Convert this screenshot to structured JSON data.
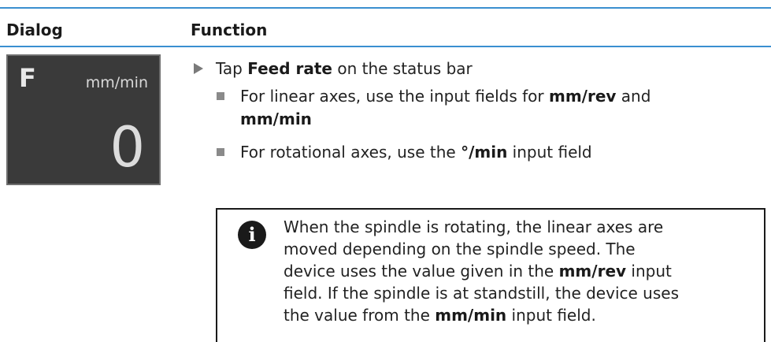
{
  "table": {
    "col_dialog": "Dialog",
    "col_function": "Function"
  },
  "tile": {
    "letter": "F",
    "unit": "mm/min",
    "value": "0"
  },
  "steps": {
    "step1_pre": "Tap ",
    "step1_bold": "Feed rate",
    "step1_post": " on the status bar",
    "bullet1_pre": "For linear axes, use the input fields for ",
    "bullet1_bold1": "mm/rev",
    "bullet1_mid": " and",
    "bullet1_bold2": "mm/min",
    "bullet2_pre": "For rotational axes, use the ",
    "bullet2_bold": "°/min",
    "bullet2_post": " input field"
  },
  "note": {
    "icon_glyph": "i",
    "line1": "When the spindle is rotating, the linear axes are",
    "line2": "moved depending on the spindle speed. The",
    "line3_pre": "device uses the value given in the ",
    "line3_bold": "mm/rev",
    "line3_post": " input",
    "line4": "field. If the spindle is at standstill, the device uses",
    "line5_pre": "the value from the ",
    "line5_bold": "mm/min",
    "line5_post": " input field."
  },
  "colors": {
    "rule": "#3a8fd0",
    "tile_bg": "#3a3a3a",
    "tile_border": "#6e6e6e"
  },
  "icons": [
    "step-arrow-icon",
    "bullet-square-icon",
    "info-icon"
  ]
}
